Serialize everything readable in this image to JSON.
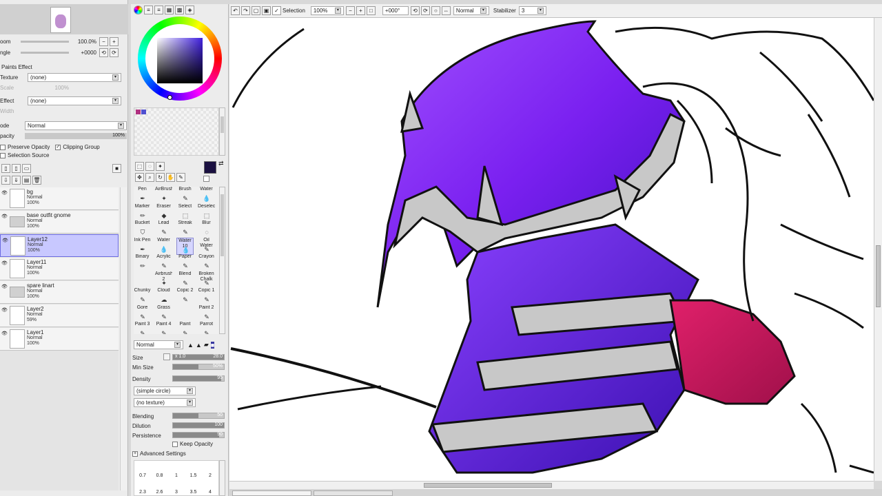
{
  "toolbar": {
    "selection_label": "Selection",
    "zoom": "100%",
    "rotation": "+000°",
    "blend_mode": "Normal",
    "stabilizer_label": "Stabilizer",
    "stabilizer_value": "3"
  },
  "navigator": {
    "zoom_value": "100.0%",
    "angle_value": "+0000",
    "zoom_label": "oom",
    "angle_label": "ngle"
  },
  "paint_effect": {
    "title": "Paints Effect",
    "texture_label": "Texture",
    "texture_value": "(none)",
    "texture_scale": "100%",
    "effect_label": "Effect",
    "effect_value": "(none)",
    "scale_label": "Scale",
    "width_label": "Width",
    "mode_label": "ode",
    "mode_value": "Normal",
    "opacity_label": "pacity",
    "opacity_value": "100%",
    "preserve_opacity_label": "Preserve Opacity",
    "clipping_group_label": "Clipping Group",
    "selection_source_label": "Selection Source"
  },
  "layers": [
    {
      "name": "bg",
      "mode": "Normal",
      "opacity": "100%",
      "type": "layer",
      "active": false
    },
    {
      "name": "base outfit gnome",
      "mode": "Normal",
      "opacity": "100%",
      "type": "folder",
      "active": false
    },
    {
      "name": "Layer12",
      "mode": "Normal",
      "opacity": "100%",
      "type": "layer",
      "active": true
    },
    {
      "name": "Layer11",
      "mode": "Normal",
      "opacity": "100%",
      "type": "layer",
      "active": false
    },
    {
      "name": "spare linart",
      "mode": "Normal",
      "opacity": "100%",
      "type": "folder",
      "active": false
    },
    {
      "name": "Layer2",
      "mode": "Normal",
      "opacity": "59%",
      "type": "layer",
      "active": false
    },
    {
      "name": "Layer1",
      "mode": "Normal",
      "opacity": "100%",
      "type": "layer",
      "active": false
    }
  ],
  "brush_tools": [
    {
      "label": "Pen",
      "icon": "pen-icon"
    },
    {
      "label": "AirBrush",
      "icon": "airbrush-icon"
    },
    {
      "label": "Brush",
      "icon": "brush-icon"
    },
    {
      "label": "Water",
      "icon": "water-icon"
    },
    {
      "label": "Marker",
      "icon": "marker-icon"
    },
    {
      "label": "Eraser",
      "icon": "eraser-icon"
    },
    {
      "label": "Select",
      "icon": "select-icon"
    },
    {
      "label": "Deselect",
      "icon": "deselect-icon"
    },
    {
      "label": "Bucket",
      "icon": "bucket-icon"
    },
    {
      "label": "Lead",
      "icon": "lead-icon"
    },
    {
      "label": "Streak",
      "icon": "streak-icon"
    },
    {
      "label": "Blur",
      "icon": "blur-icon"
    },
    {
      "label": "Ink Pen",
      "icon": "ink-pen-icon"
    },
    {
      "label": "Water",
      "icon": "water-icon"
    },
    {
      "label": "Water 10",
      "icon": "water-icon"
    },
    {
      "label": "Oil Water",
      "icon": "oil-water-icon"
    },
    {
      "label": "Binary",
      "icon": "binary-icon"
    },
    {
      "label": "Acrylic",
      "icon": "acrylic-icon"
    },
    {
      "label": "Paper",
      "icon": "paper-icon"
    },
    {
      "label": "Crayon",
      "icon": "crayon-icon"
    },
    {
      "label": "",
      "icon": "blank"
    },
    {
      "label": "Airbrush 2",
      "icon": "airbrush-icon"
    },
    {
      "label": "Blend",
      "icon": "blend-icon"
    },
    {
      "label": "Broken Chalk",
      "icon": "chalk-icon"
    },
    {
      "label": "Chunky",
      "icon": "chunky-icon"
    },
    {
      "label": "Cloud",
      "icon": "cloud-icon"
    },
    {
      "label": "Copic 2",
      "icon": "copic-icon"
    },
    {
      "label": "Copic 1",
      "icon": "copic-icon"
    },
    {
      "label": "Gore",
      "icon": "gore-icon"
    },
    {
      "label": "Grass",
      "icon": "grass-icon"
    },
    {
      "label": "",
      "icon": "blank"
    },
    {
      "label": "Paint 2",
      "icon": "paint-icon"
    },
    {
      "label": "Paint 3",
      "icon": "paint-icon"
    },
    {
      "label": "Paint 4",
      "icon": "paint-icon"
    },
    {
      "label": "Paint",
      "icon": "paint-icon"
    },
    {
      "label": "Parrot",
      "icon": "parrot-icon"
    }
  ],
  "brush_settings": {
    "blend_mode": "Normal",
    "size_label": "Size",
    "size_mult": "x 1.0",
    "size_value": "28.0",
    "min_size_label": "Min Size",
    "min_size_value": "50%",
    "min_size_fraction": 0.5,
    "density_label": "Density",
    "density_value": "95",
    "density_fraction": 0.95,
    "shape": "(simple circle)",
    "texture": "(no texture)",
    "blending_label": "Blending",
    "blending_value": "50",
    "blending_fraction": 0.5,
    "dilution_label": "Dilution",
    "dilution_value": "100",
    "dilution_fraction": 1.0,
    "persistence_label": "Persistence",
    "persistence_value": "90",
    "persistence_fraction": 0.9,
    "keep_opacity_label": "Keep Opacity",
    "advanced_label": "Advanced Settings"
  },
  "size_presets": [
    "0.7",
    "0.8",
    "1",
    "1.5",
    "2",
    "2.3",
    "2.6",
    "3",
    "3.5",
    "4"
  ],
  "colors": {
    "accent": "#c8c8ff",
    "current_color": "#1a1040",
    "swatch1": "#b03080",
    "swatch2": "#5050d0"
  }
}
